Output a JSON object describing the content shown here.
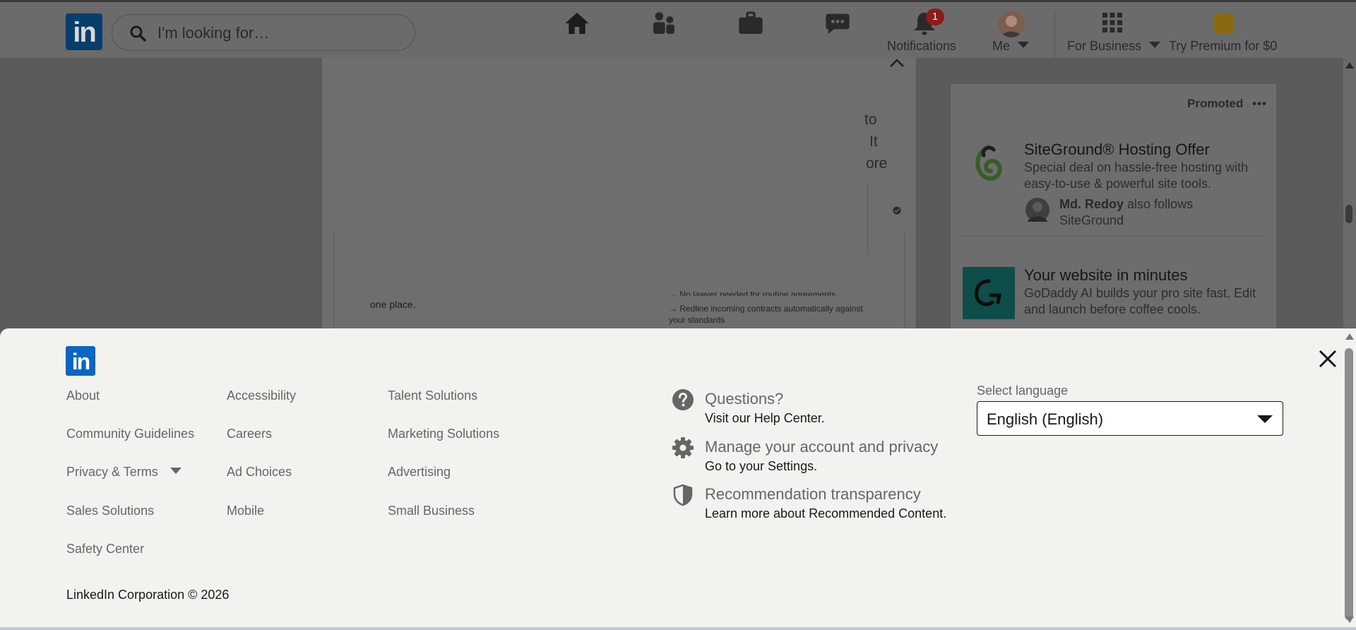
{
  "header": {
    "logo": "in",
    "search_placeholder": "I'm looking for…",
    "nav": {
      "notifications_label": "Notifications",
      "notifications_badge": "1",
      "me_label": "Me",
      "for_business_label": "For Business",
      "premium_label": "Try Premium for $0"
    }
  },
  "feed": {
    "snippet_right": [
      "to",
      "It",
      "ore"
    ],
    "snippet_left": "one place.",
    "snippet_list": [
      "→ No lawyer needed for routine agreements",
      "→ Redline incoming contracts automatically against",
      "your standards"
    ]
  },
  "sidebar": {
    "promoted_label": "Promoted",
    "ads": [
      {
        "title": "SiteGround® Hosting Offer",
        "description": "Special deal on hassle-free hosting with easy-to-use & powerful site tools.",
        "follower_name": "Md. Redoy",
        "follower_suffix": "also follows SiteGround"
      },
      {
        "title": "Your website in minutes",
        "description": "GoDaddy AI builds your pro site fast. Edit and launch before coffee cools."
      }
    ]
  },
  "footer": {
    "logo": "in",
    "columns": [
      [
        "About",
        "Community Guidelines",
        "Privacy & Terms",
        "Sales Solutions",
        "Safety Center"
      ],
      [
        "Accessibility",
        "Careers",
        "Ad Choices",
        "Mobile"
      ],
      [
        "Talent Solutions",
        "Marketing Solutions",
        "Advertising",
        "Small Business"
      ]
    ],
    "help": [
      {
        "icon": "question-icon",
        "title": "Questions?",
        "subtitle": "Visit our Help Center."
      },
      {
        "icon": "gear-icon",
        "title": "Manage your account and privacy",
        "subtitle": "Go to your Settings."
      },
      {
        "icon": "shield-icon",
        "title": "Recommendation transparency",
        "subtitle": "Learn more about Recommended Content."
      }
    ],
    "language": {
      "label": "Select language",
      "selected": "English (English)"
    },
    "copyright": "LinkedIn Corporation © 2026"
  },
  "colors": {
    "brand": "#0a66c2",
    "footer_bg": "#f3f2ef",
    "overlay": "#5b5b5b",
    "link_text": "#666666"
  }
}
